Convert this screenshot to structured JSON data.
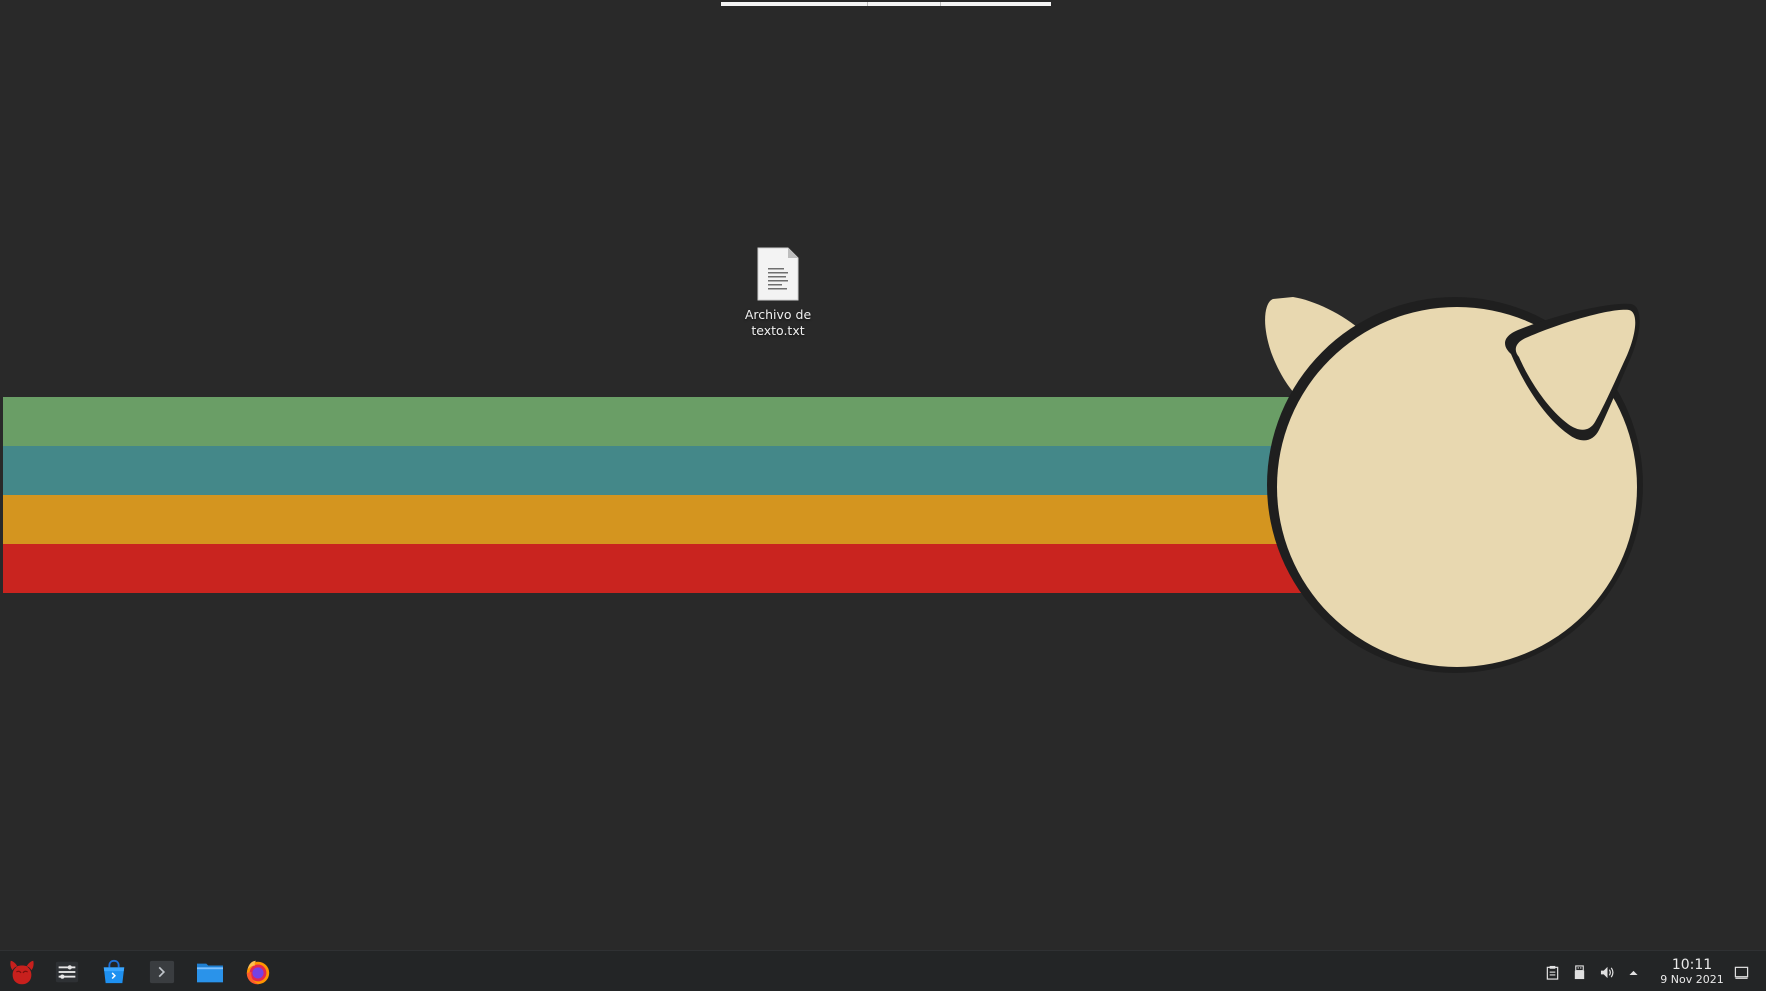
{
  "desktop": {
    "background_color": "#292929",
    "files": [
      {
        "name": "Archivo de texto.txt",
        "label_line1": "Archivo de",
        "label_line2": "texto.txt",
        "icon": "text-file-icon"
      }
    ]
  },
  "wallpaper": {
    "stripes": [
      {
        "color": "#6a9e66"
      },
      {
        "color": "#448889"
      },
      {
        "color": "#d4951f"
      },
      {
        "color": "#c9241f"
      }
    ],
    "mascot_color": "#e8d8b0"
  },
  "taskbar": {
    "launchers": [
      {
        "name": "application-menu",
        "icon": "freebsd-logo-icon"
      },
      {
        "name": "system-settings",
        "icon": "settings-sliders-icon"
      },
      {
        "name": "software-store",
        "icon": "shopping-bag-icon"
      },
      {
        "name": "terminal",
        "icon": "terminal-icon"
      },
      {
        "name": "file-manager",
        "icon": "folder-icon"
      },
      {
        "name": "firefox",
        "icon": "firefox-icon"
      }
    ],
    "tray": [
      {
        "name": "clipboard",
        "icon": "clipboard-icon"
      },
      {
        "name": "removable-devices",
        "icon": "usb-drive-icon"
      },
      {
        "name": "volume",
        "icon": "speaker-icon"
      },
      {
        "name": "show-hidden-icons",
        "icon": "chevron-up-icon"
      }
    ],
    "clock": {
      "time": "10:11",
      "date": "9 Nov 2021"
    }
  }
}
